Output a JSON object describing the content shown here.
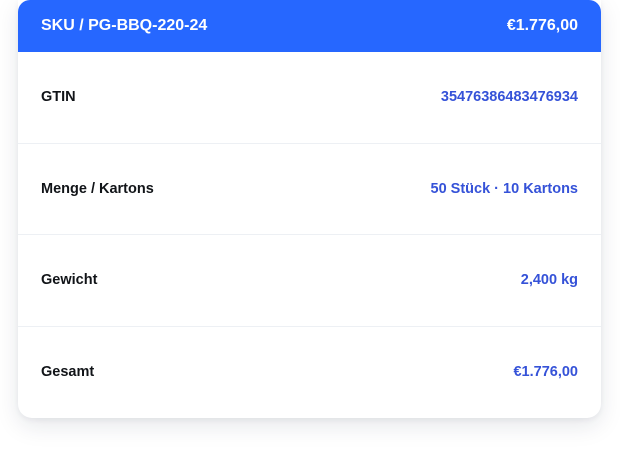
{
  "header": {
    "sku": "SKU / PG-BBQ-220-24",
    "price": "€1.776,00"
  },
  "rows": [
    {
      "label": "GTIN",
      "value": "35476386483476934"
    },
    {
      "label": "Menge / Kartons",
      "value": "50 Stück · 10 Kartons"
    },
    {
      "label": "Gewicht",
      "value": "2,400 kg"
    },
    {
      "label": "Gesamt",
      "value": "€1.776,00"
    }
  ],
  "colors": {
    "header_bg": "#2667ff",
    "value_text": "#3552d8",
    "label_text": "#111418"
  }
}
